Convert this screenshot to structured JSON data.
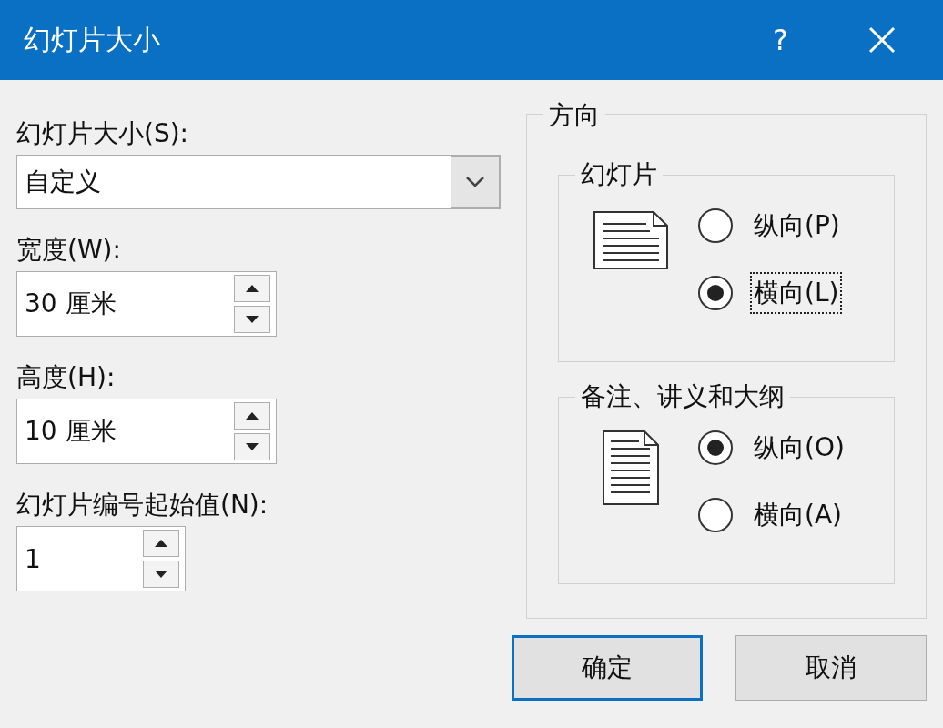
{
  "window": {
    "title": "幻灯片大小",
    "help": "?"
  },
  "fields": [
    {
      "kind": "combo",
      "label": "幻灯片大小(S):",
      "value": "自定义"
    },
    {
      "kind": "spin",
      "label": "宽度(W):",
      "value": "30 厘米"
    },
    {
      "kind": "spin",
      "label": "高度(H):",
      "value": "10 厘米"
    },
    {
      "kind": "spin-small",
      "label": "幻灯片编号起始值(N):",
      "value": "1"
    }
  ],
  "orientation": {
    "title": "方向",
    "groups": [
      {
        "title": "幻灯片",
        "kind": "landscape",
        "options": [
          {
            "label": "纵向(P)",
            "selected": false,
            "focused": false
          },
          {
            "label": "横向(L)",
            "selected": true,
            "focused": true
          }
        ]
      },
      {
        "title": "备注、讲义和大纲",
        "kind": "portrait",
        "options": [
          {
            "label": "纵向(O)",
            "selected": true,
            "focused": false
          },
          {
            "label": "横向(A)",
            "selected": false,
            "focused": false
          }
        ]
      }
    ]
  },
  "buttons": [
    {
      "label": "确定",
      "default": true
    },
    {
      "label": "取消",
      "default": false
    }
  ]
}
